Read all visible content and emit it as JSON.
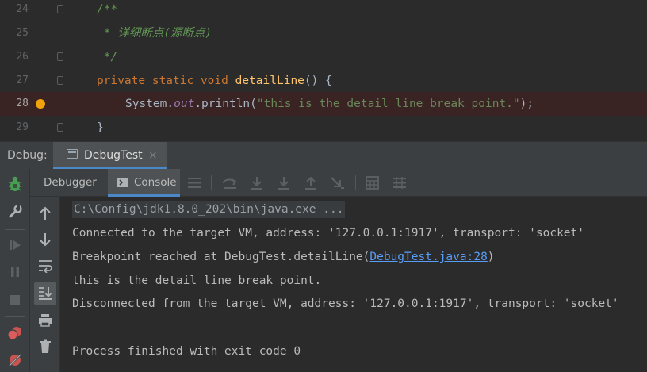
{
  "editor": {
    "lines": [
      {
        "num": "24",
        "text": "/**"
      },
      {
        "num": "25",
        "text": " * 详细断点(源断点)"
      },
      {
        "num": "26",
        "text": " */"
      },
      {
        "num": "27",
        "kw": "private static void ",
        "fn": "detailLine",
        "rest": "() {"
      },
      {
        "num": "28",
        "pre": "System.",
        "field": "out",
        "call": ".println(",
        "str": "\"this is the detail line break point.\"",
        "end": ");"
      },
      {
        "num": "29",
        "text": "}"
      }
    ],
    "breakpoint_line": "28",
    "breakpoint_color": "#f0a30a"
  },
  "debug": {
    "label": "Debug:",
    "session_tab": "DebugTest",
    "close_glyph": "×",
    "tabs": {
      "debugger": "Debugger",
      "console": "Console"
    }
  },
  "console": {
    "cmd": "C:\\Config\\jdk1.8.0_202\\bin\\java.exe ...",
    "connected": "Connected to the target VM, address: '127.0.0.1:1917', transport: 'socket'",
    "breakpoint_prefix": "Breakpoint reached at DebugTest.detailLine(",
    "breakpoint_link": "DebugTest.java:28",
    "breakpoint_suffix": ")",
    "output": "this is the detail line break point.",
    "disconnected": "Disconnected from the target VM, address: '127.0.0.1:1917', transport: 'socket'",
    "finished": "Process finished with exit code 0"
  },
  "icons": {
    "sidebar": [
      "bug-icon",
      "wrench-icon",
      "resume-icon",
      "pause-icon",
      "stop-icon",
      "view-breakpoints-icon",
      "mute-breakpoints-icon"
    ],
    "console_toolbar": [
      "up-arrow-icon",
      "down-arrow-icon",
      "soft-wrap-icon",
      "scroll-to-end-icon",
      "print-icon",
      "trash-icon"
    ],
    "debugger_toolbar": [
      "menu-icon",
      "show-execution-point-icon",
      "step-over-icon",
      "step-into-icon",
      "force-step-into-icon",
      "step-out-icon",
      "run-to-cursor-icon",
      "evaluate-icon",
      "trace-icon"
    ]
  },
  "colors": {
    "keyword": "#cc7832",
    "function": "#ffc66d",
    "comment": "#629755",
    "string": "#6a8759",
    "link": "#589df6",
    "accent": "#4a88c7"
  }
}
